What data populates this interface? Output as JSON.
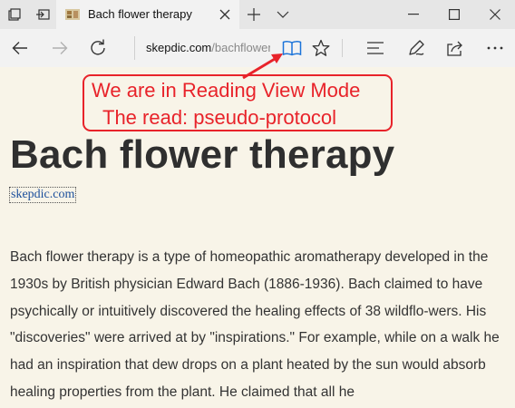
{
  "browser": {
    "tab": {
      "title": "Bach flower therapy"
    },
    "address": {
      "domain": "skepdic.com",
      "path": "/bachflower.html"
    }
  },
  "icons": {
    "tab_actions": "tab-actions-icon",
    "set_aside": "set-aside-tabs-icon",
    "favicon": "page-favicon-icon",
    "close_tab": "close-icon",
    "new_tab": "plus-icon",
    "tab_preview": "chevron-down-icon",
    "minimize": "minimize-icon",
    "maximize": "maximize-icon",
    "close_window": "close-icon",
    "back": "back-arrow-icon",
    "forward": "forward-arrow-icon",
    "refresh": "refresh-icon",
    "reading_view": "book-icon",
    "favorite": "star-icon",
    "hub": "hub-icon",
    "notes": "pen-icon",
    "share": "share-icon",
    "more": "ellipsis-icon"
  },
  "colors": {
    "annotation": "#e8232a",
    "reading_bg": "#f8f4e8",
    "link": "#1a4e9b",
    "reading_view_icon": "#1a73d9"
  },
  "annotation": {
    "line1": "We are in Reading View Mode",
    "line2": "The read: pseudo-protocol"
  },
  "article": {
    "title": "Bach flower therapy",
    "source": "skepdic.com",
    "body": "Bach flower therapy is a type of homeopathic aromatherapy developed in the 1930s by British physician Edward Bach (1886-1936). Bach claimed to have psychically or intuitively discovered the healing effects of 38 wildflo-wers. His \"discoveries\" were arrived at by \"inspirations.\" For example, while on a walk he had an inspiration that dew drops on a plant heated by the sun would absorb healing properties from the plant. He claimed that all he"
  }
}
